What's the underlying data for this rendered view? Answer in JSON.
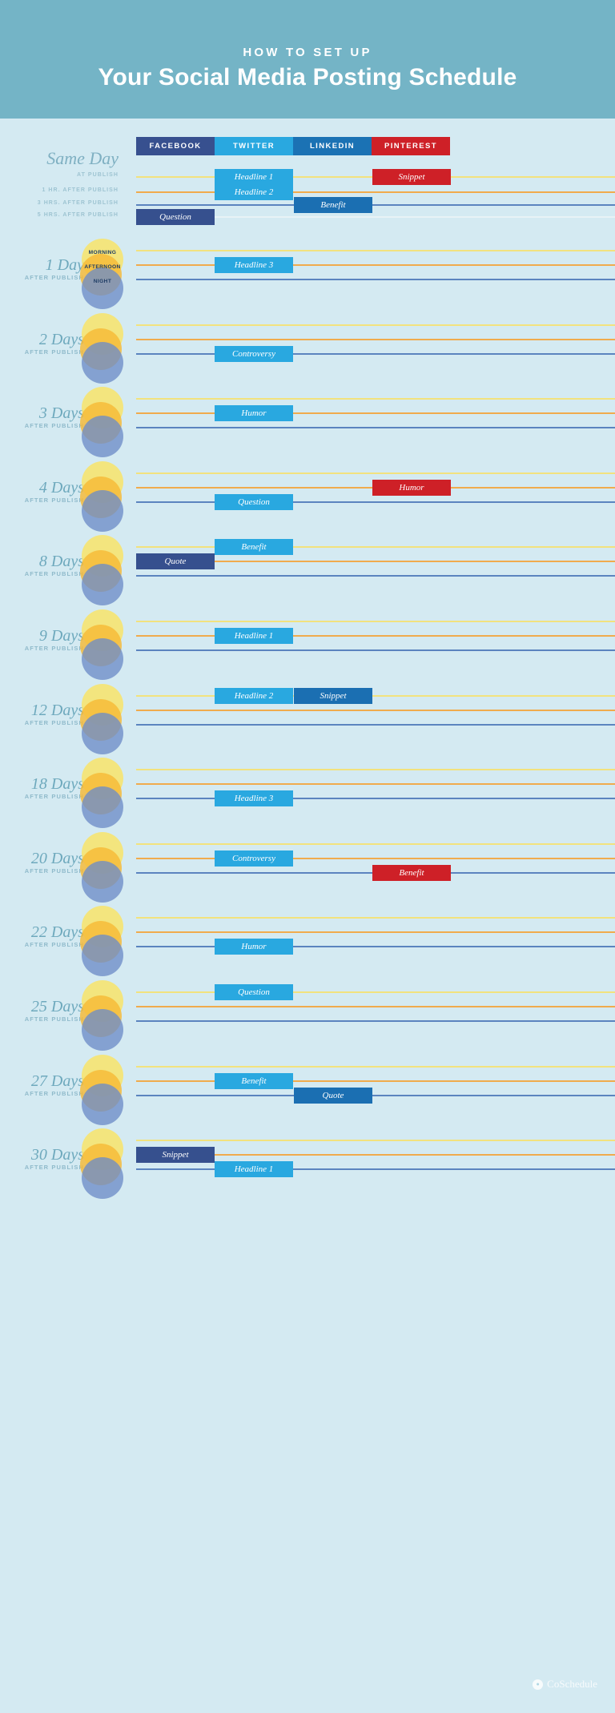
{
  "banner": {
    "kicker": "HOW TO SET UP",
    "title": "Your Social Media Posting Schedule",
    "bg_color": "#74b4c6"
  },
  "page": {
    "bg_color": "#d4eaf2"
  },
  "platforms": [
    {
      "name": "FACEBOOK",
      "color": "#37508f"
    },
    {
      "name": "TWITTER",
      "color": "#29a8e0"
    },
    {
      "name": "LINKEDIN",
      "color": "#1b72b4"
    },
    {
      "name": "PINTEREST",
      "color": "#ce2027"
    }
  ],
  "same_day": {
    "label": "Same Day",
    "rows": [
      {
        "caption": "AT PUBLISH",
        "line_color": "#f2e27e"
      },
      {
        "caption": "1 HR. AFTER PUBLISH",
        "line_color": "#f0ab4d"
      },
      {
        "caption": "3 HRS. AFTER PUBLISH",
        "line_color": "#5b84bf"
      },
      {
        "caption": "5 HRS. AFTER PUBLISH",
        "line_color": "#e8f2f6"
      }
    ],
    "bars": [
      {
        "label": "Headline 1",
        "platform": "twitter",
        "row": 0
      },
      {
        "label": "Snippet",
        "platform": "pinterest",
        "row": 0
      },
      {
        "label": "Headline 2",
        "platform": "twitter",
        "row": 1
      },
      {
        "label": "Benefit",
        "platform": "linkedin",
        "row": 2
      },
      {
        "label": "Question",
        "platform": "facebook",
        "row": 3
      }
    ]
  },
  "time_of_day": {
    "morning": {
      "label": "MORNING",
      "color": "#f8e46a"
    },
    "afternoon": {
      "label": "AFTERNOON",
      "color": "#f7b936"
    },
    "night": {
      "label": "NIGHT",
      "color": "#6d8cc8"
    }
  },
  "days": [
    {
      "title": "1 Day",
      "sub": "AFTER PUBLISH",
      "show_circle_labels": true,
      "bars": [
        {
          "label": "Headline 3",
          "platform": "twitter",
          "line": "afternoon"
        }
      ]
    },
    {
      "title": "2 Days",
      "sub": "AFTER PUBLISH",
      "show_circle_labels": false,
      "bars": [
        {
          "label": "Controversy",
          "platform": "twitter",
          "line": "night"
        }
      ]
    },
    {
      "title": "3 Days",
      "sub": "AFTER PUBLISH",
      "show_circle_labels": false,
      "bars": [
        {
          "label": "Humor",
          "platform": "twitter",
          "line": "afternoon"
        }
      ]
    },
    {
      "title": "4 Days",
      "sub": "AFTER PUBLISH",
      "show_circle_labels": false,
      "bars": [
        {
          "label": "Humor",
          "platform": "pinterest",
          "line": "afternoon"
        },
        {
          "label": "Question",
          "platform": "twitter",
          "line": "night"
        }
      ]
    },
    {
      "title": "8 Days",
      "sub": "AFTER PUBLISH",
      "show_circle_labels": false,
      "bars": [
        {
          "label": "Benefit",
          "platform": "twitter",
          "line": "morning"
        },
        {
          "label": "Quote",
          "platform": "facebook",
          "line": "afternoon"
        }
      ]
    },
    {
      "title": "9 Days",
      "sub": "AFTER PUBLISH",
      "show_circle_labels": false,
      "bars": [
        {
          "label": "Headline 1",
          "platform": "twitter",
          "line": "afternoon"
        }
      ]
    },
    {
      "title": "12 Days",
      "sub": "AFTER PUBLISH",
      "show_circle_labels": false,
      "bars": [
        {
          "label": "Headline 2",
          "platform": "twitter",
          "line": "morning"
        },
        {
          "label": "Snippet",
          "platform": "linkedin",
          "line": "morning"
        }
      ]
    },
    {
      "title": "18 Days",
      "sub": "AFTER PUBLISH",
      "show_circle_labels": false,
      "bars": [
        {
          "label": "Headline 3",
          "platform": "twitter",
          "line": "night"
        }
      ]
    },
    {
      "title": "20 Days",
      "sub": "AFTER PUBLISH",
      "show_circle_labels": false,
      "bars": [
        {
          "label": "Controversy",
          "platform": "twitter",
          "line": "afternoon"
        },
        {
          "label": "Benefit",
          "platform": "pinterest",
          "line": "night"
        }
      ]
    },
    {
      "title": "22 Days",
      "sub": "AFTER PUBLISH",
      "show_circle_labels": false,
      "bars": [
        {
          "label": "Humor",
          "platform": "twitter",
          "line": "night"
        }
      ]
    },
    {
      "title": "25 Days",
      "sub": "AFTER PUBLISH",
      "show_circle_labels": false,
      "bars": [
        {
          "label": "Question",
          "platform": "twitter",
          "line": "morning"
        }
      ]
    },
    {
      "title": "27 Days",
      "sub": "AFTER PUBLISH",
      "show_circle_labels": false,
      "bars": [
        {
          "label": "Benefit",
          "platform": "twitter",
          "line": "afternoon"
        },
        {
          "label": "Quote",
          "platform": "linkedin",
          "line": "night"
        }
      ]
    },
    {
      "title": "30 Days",
      "sub": "AFTER PUBLISH",
      "show_circle_labels": false,
      "bars": [
        {
          "label": "Snippet",
          "platform": "facebook",
          "line": "afternoon"
        },
        {
          "label": "Headline 1",
          "platform": "twitter",
          "line": "night"
        }
      ]
    }
  ],
  "footer": {
    "brand": "CoSchedule",
    "mark": "co-schedule-icon"
  }
}
